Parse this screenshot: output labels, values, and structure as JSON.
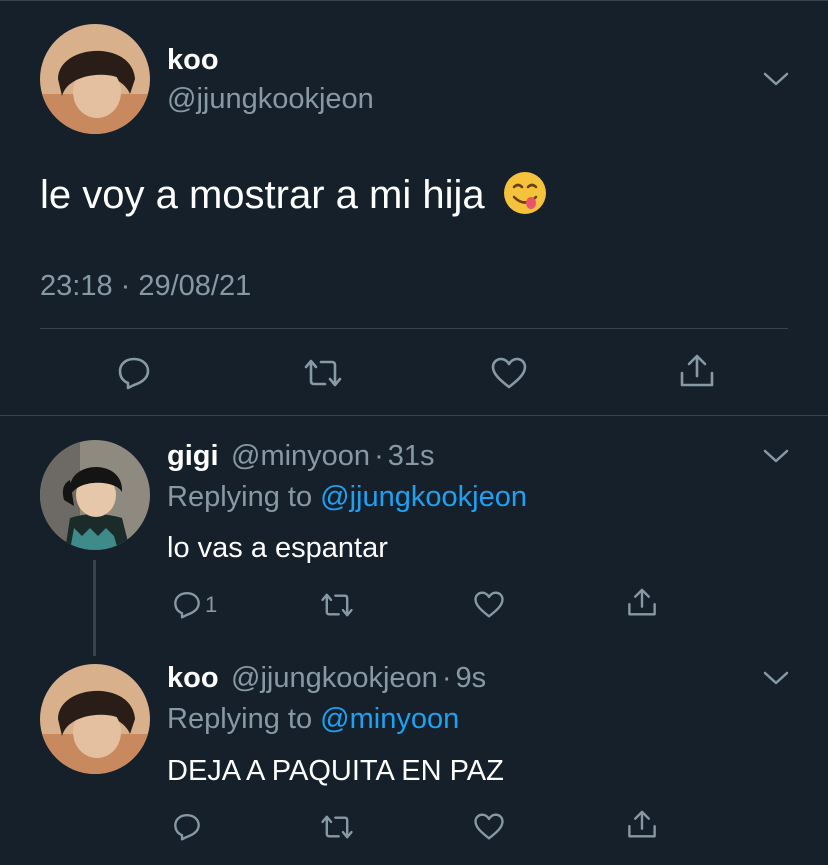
{
  "main_tweet": {
    "author_name": "koo",
    "author_handle": "@jjungkookjeon",
    "text": "le voy a mostrar a mi hija",
    "emoji": "😋",
    "timestamp": "23:18 · 29/08/21",
    "avatar_icon": "profile-photo"
  },
  "replies": [
    {
      "author_name": "gigi",
      "author_handle": "@minyoon",
      "separator": "·",
      "age": "31s",
      "replying_prefix": "Replying to ",
      "replying_to": "@jjungkookjeon",
      "text": "lo vas a espantar",
      "reply_count": "1"
    },
    {
      "author_name": "koo",
      "author_handle": "@jjungkookjeon",
      "separator": "·",
      "age": "9s",
      "replying_prefix": "Replying to ",
      "replying_to": "@minyoon",
      "text": "DEJA A PAQUITA EN PAZ",
      "reply_count": ""
    }
  ],
  "colors": {
    "background": "#15202b",
    "text": "#ffffff",
    "muted": "#8899a6",
    "link": "#1da1f2",
    "divider": "#38444d"
  },
  "icons": [
    "reply-icon",
    "retweet-icon",
    "like-icon",
    "share-icon",
    "chevron-down-icon"
  ]
}
